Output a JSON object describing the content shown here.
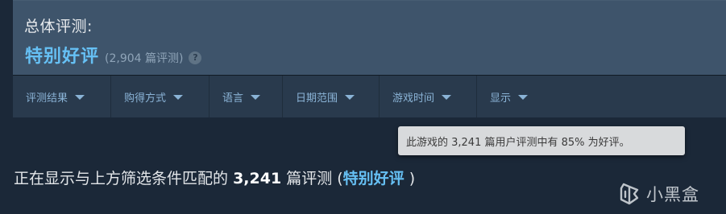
{
  "summary": {
    "overall_label": "总体评测:",
    "rating": "特别好评",
    "review_count": "(2,904 篇评测)",
    "help_icon_glyph": "?"
  },
  "filters": [
    {
      "label": "评测结果"
    },
    {
      "label": "购得方式"
    },
    {
      "label": "语言"
    },
    {
      "label": "日期范围"
    },
    {
      "label": "游戏时间"
    },
    {
      "label": "显示"
    }
  ],
  "tooltip": {
    "text": "此游戏的 3,241 篇用户评测中有 85% 为好评。"
  },
  "results": {
    "prefix": "正在显示与上方筛选条件匹配的",
    "count": "3,241",
    "suffix": "篇评测 (",
    "rating": "特别好评",
    "close": ")"
  },
  "watermark": {
    "label": "小黑盒"
  },
  "colors": {
    "accent": "#66c0f4",
    "background": "#1b2838",
    "panel": "#3e546b",
    "filter_bar": "#293a4d"
  }
}
